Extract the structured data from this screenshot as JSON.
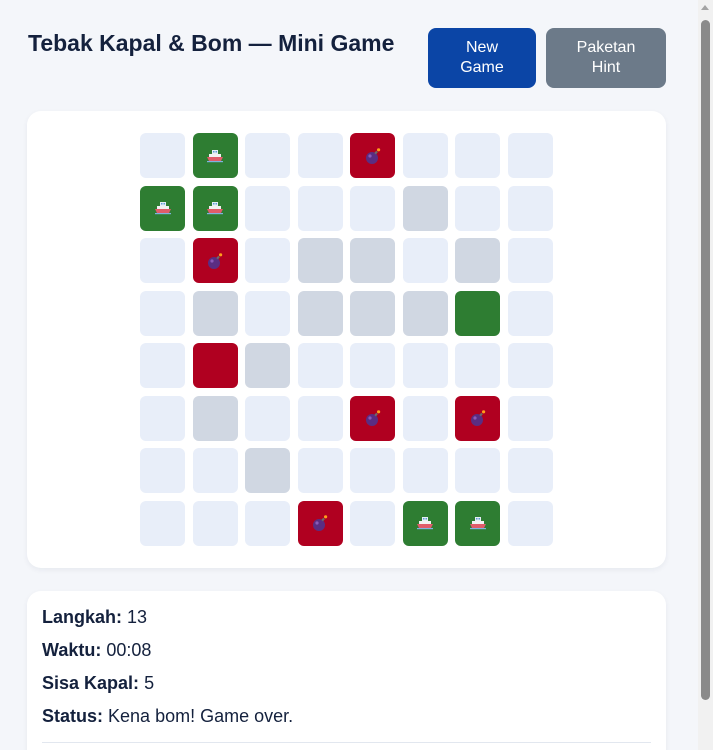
{
  "header": {
    "title": "Tebak Kapal & Bom — Mini Game",
    "new_game_label": "New Game",
    "hint_label": "Paketan Hint"
  },
  "board": {
    "rows": 8,
    "cols": 8,
    "colors": {
      "hidden": "#e8eef9",
      "revealed": "#d0d7e2",
      "ship": "#2e7d32",
      "bomb": "#b00020"
    },
    "cells": [
      [
        "hidden",
        "ship-icon",
        "hidden",
        "hidden",
        "bomb-icon",
        "hidden",
        "hidden",
        "hidden"
      ],
      [
        "ship-icon",
        "ship-icon",
        "hidden",
        "hidden",
        "hidden",
        "revealed",
        "hidden",
        "hidden"
      ],
      [
        "hidden",
        "bomb-icon",
        "hidden",
        "revealed",
        "revealed",
        "hidden",
        "revealed",
        "hidden"
      ],
      [
        "hidden",
        "revealed",
        "hidden",
        "revealed",
        "revealed",
        "revealed",
        "ship",
        "hidden"
      ],
      [
        "hidden",
        "bomb",
        "revealed",
        "hidden",
        "hidden",
        "hidden",
        "hidden",
        "hidden"
      ],
      [
        "hidden",
        "revealed",
        "hidden",
        "hidden",
        "bomb-icon",
        "hidden",
        "bomb-icon",
        "hidden"
      ],
      [
        "hidden",
        "hidden",
        "revealed",
        "hidden",
        "hidden",
        "hidden",
        "hidden",
        "hidden"
      ],
      [
        "hidden",
        "hidden",
        "hidden",
        "bomb-icon",
        "hidden",
        "ship-icon",
        "ship-icon",
        "hidden"
      ]
    ]
  },
  "stats": {
    "moves_label": "Langkah:",
    "moves_value": "13",
    "time_label": "Waktu:",
    "time_value": "00:08",
    "ships_left_label": "Sisa Kapal:",
    "ships_left_value": "5",
    "status_label": "Status:",
    "status_value": "Kena bom! Game over."
  }
}
